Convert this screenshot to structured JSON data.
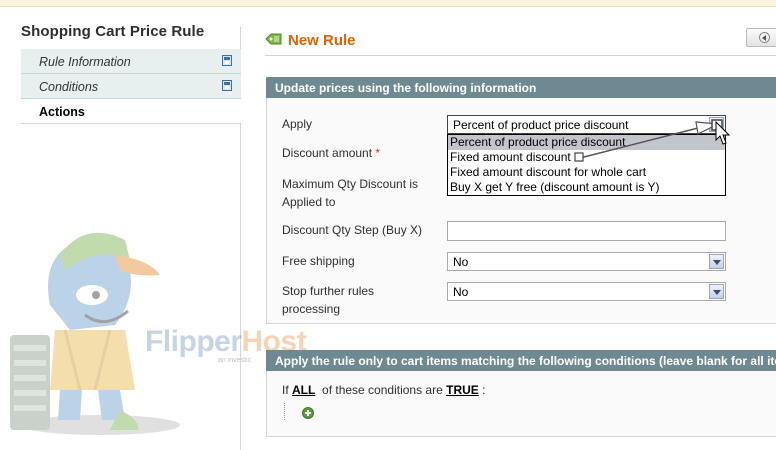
{
  "sidebar": {
    "title": "Shopping Cart Price Rule",
    "tabs": [
      {
        "label": "Rule Information"
      },
      {
        "label": "Conditions"
      },
      {
        "label": "Actions"
      }
    ]
  },
  "branding": {
    "logo_part1": "Flipper",
    "logo_part2": "Host",
    "tagline": "an investic"
  },
  "header": {
    "title": "New Rule"
  },
  "section_actions": {
    "heading": "Update prices using the following information",
    "apply_label": "Apply",
    "apply_value": "Percent of product price discount",
    "apply_options": [
      "Percent of product price discount",
      "Fixed amount discount",
      "Fixed amount discount for whole cart",
      "Buy X get Y free (discount amount is Y)"
    ],
    "discount_amount_label": "Discount amount",
    "required_mark": "*",
    "max_qty_label_line1": "Maximum Qty Discount is",
    "max_qty_label_line2": "Applied to",
    "qty_step_label": "Discount Qty Step (Buy X)",
    "free_shipping_label": "Free shipping",
    "free_shipping_value": "No",
    "stop_rules_label_line1": "Stop further rules",
    "stop_rules_label_line2": "processing",
    "stop_rules_value": "No"
  },
  "section_conditions": {
    "heading": "Apply the rule only to cart items matching the following conditions (leave blank for all items)",
    "if_prefix": "If",
    "all_keyword": "ALL",
    "middle_text": "of these conditions are",
    "true_keyword": "TRUE",
    "suffix": ":"
  },
  "colors": {
    "accent": "#eb5e00",
    "section_header": "#6f8992",
    "tab_bg": "#e7efef"
  }
}
